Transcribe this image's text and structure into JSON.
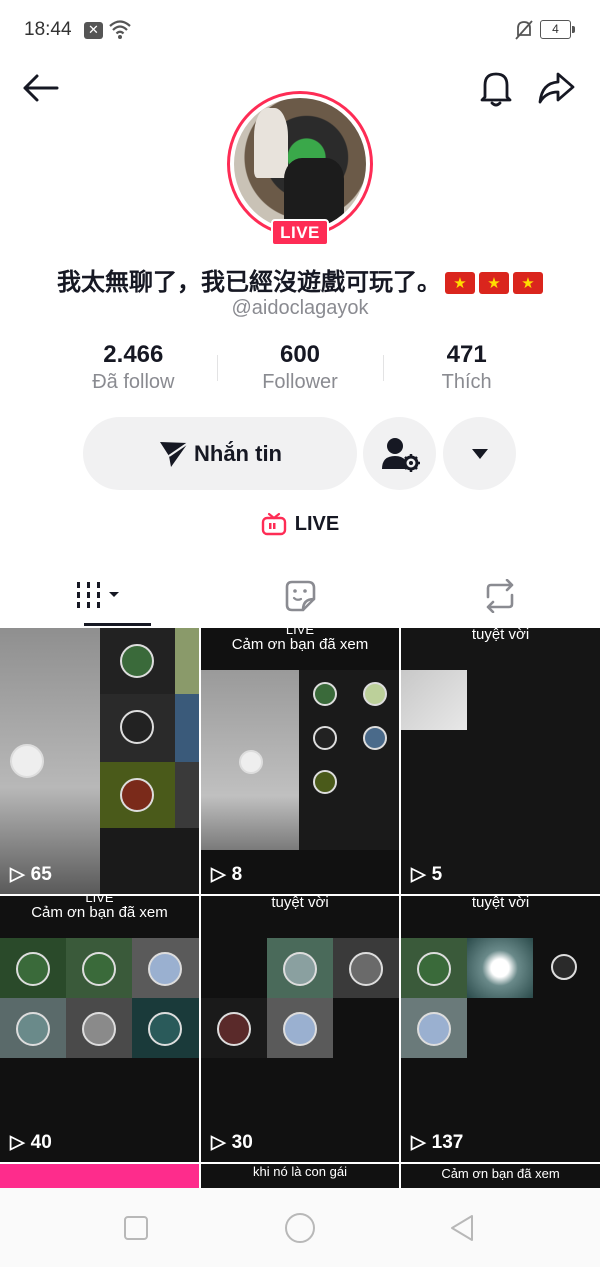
{
  "status_bar": {
    "time": "18:44",
    "battery": "4"
  },
  "header": {
    "back_icon": "arrow-left-icon",
    "notification_icon": "bell-icon",
    "share_icon": "share-arrow-icon"
  },
  "profile": {
    "live_badge": "LIVE",
    "display_name": "我太無聊了，我已經沒遊戲可玩了。",
    "flag_count": 3,
    "username": "@aidoclagayok"
  },
  "stats": [
    {
      "value": "2.466",
      "label": "Đã follow"
    },
    {
      "value": "600",
      "label": "Follower"
    },
    {
      "value": "471",
      "label": "Thích"
    }
  ],
  "actions": {
    "message_label": "Nhắn tin",
    "live_link_label": "LIVE"
  },
  "tabs": [
    {
      "icon": "videos-grid-icon",
      "selected": true
    },
    {
      "icon": "sticker-icon",
      "selected": false
    },
    {
      "icon": "repost-icon",
      "selected": false
    }
  ],
  "videos": [
    {
      "views": "65",
      "overlay": ""
    },
    {
      "views": "8",
      "overlay": "Cảm ơn bạn đã xem",
      "top_label": "LIVE"
    },
    {
      "views": "5",
      "overlay": "tuyệt vời"
    },
    {
      "views": "40",
      "overlay": "Cảm ơn bạn đã xem",
      "top_label": "LIVE"
    },
    {
      "views": "30",
      "overlay": "tuyệt vời"
    },
    {
      "views": "137",
      "overlay": "tuyệt vời"
    },
    {
      "views": "",
      "overlay": ""
    },
    {
      "views": "",
      "overlay": "khi nó là con gái"
    },
    {
      "views": "",
      "overlay": "Cảm ơn bạn đã xem"
    }
  ],
  "colors": {
    "accent": "#fe2c55",
    "text": "#161823",
    "secondary": "#8a8b91"
  }
}
